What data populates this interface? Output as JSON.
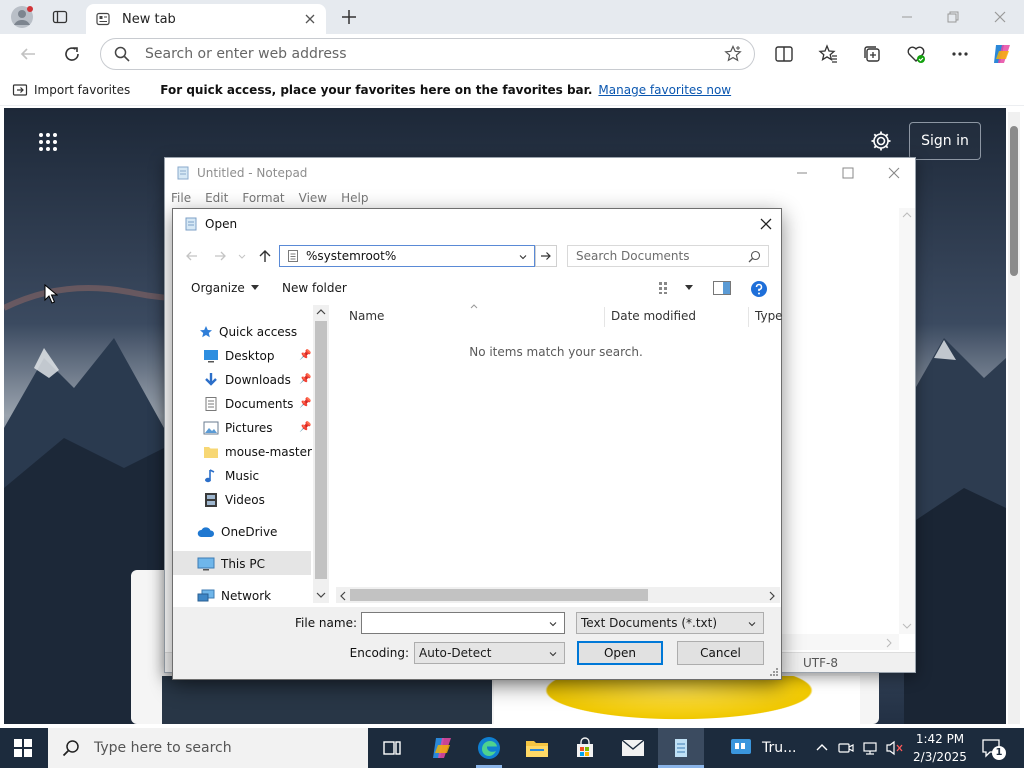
{
  "browser": {
    "tab_title": "New tab",
    "address_placeholder": "Search or enter web address",
    "import_favorites": "Import favorites",
    "favbar_message": "For quick access, place your favorites here on the favorites bar.",
    "manage_favorites": "Manage favorites now",
    "sign_in": "Sign in"
  },
  "notepad": {
    "title": "Untitled - Notepad",
    "menu": [
      "File",
      "Edit",
      "Format",
      "View",
      "Help"
    ],
    "encoding_status": "UTF-8"
  },
  "dialog": {
    "title": "Open",
    "path": "%systemroot%",
    "search_placeholder": "Search Documents",
    "organize": "Organize",
    "new_folder": "New folder",
    "nav": {
      "quick_access": "Quick access",
      "desktop": "Desktop",
      "downloads": "Downloads",
      "documents": "Documents",
      "pictures": "Pictures",
      "mouse_master": "mouse-master",
      "music": "Music",
      "videos": "Videos",
      "onedrive": "OneDrive",
      "this_pc": "This PC",
      "network": "Network"
    },
    "columns": {
      "name": "Name",
      "date_modified": "Date modified",
      "type": "Type"
    },
    "empty_message": "No items match your search.",
    "file_name_label": "File name:",
    "file_name_value": "",
    "file_type": "Text Documents (*.txt)",
    "encoding_label": "Encoding:",
    "encoding_value": "Auto-Detect",
    "open_button": "Open",
    "cancel_button": "Cancel"
  },
  "taskbar": {
    "search_placeholder": "Type here to search",
    "app_label": "Tru...",
    "time": "1:42 PM",
    "date": "2/3/2025",
    "notification_count": "1"
  },
  "colors": {
    "accent": "#0078d7",
    "link": "#0b57b0",
    "taskbar": "#1c2b3d"
  }
}
